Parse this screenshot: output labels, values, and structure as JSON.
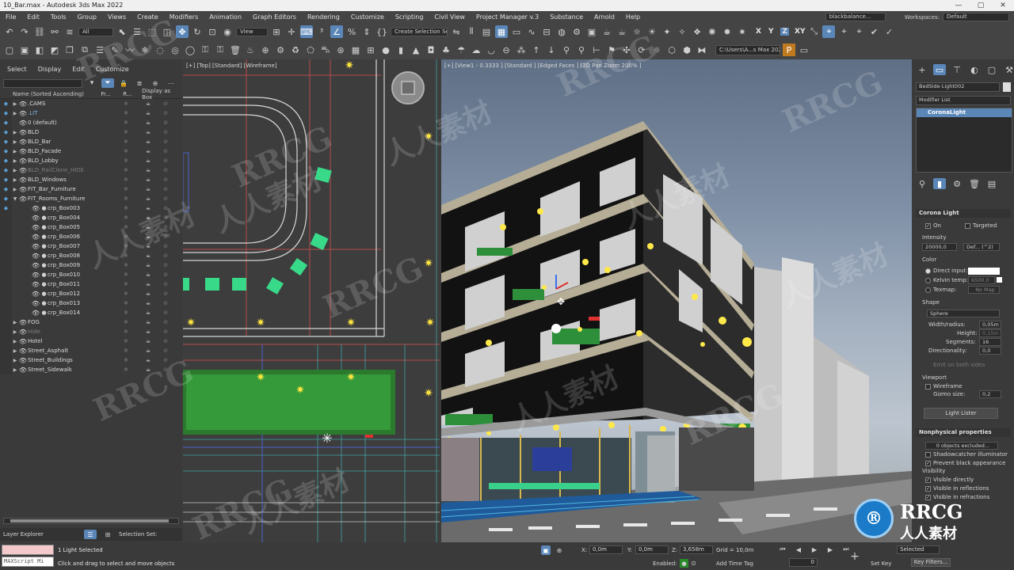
{
  "title_bar": {
    "title": "10_Bar.max - Autodesk 3ds Max 2022",
    "minimize": "—",
    "maximize": "▢",
    "close": "✕"
  },
  "menu": {
    "items": [
      "File",
      "Edit",
      "Tools",
      "Group",
      "Views",
      "Create",
      "Modifiers",
      "Animation",
      "Graph Editors",
      "Rendering",
      "Customize",
      "Scripting",
      "Civil View",
      "Project Manager v.3",
      "Substance",
      "Arnold",
      "Help"
    ],
    "user": "blackbalance...",
    "workspaces_label": "Workspaces:",
    "workspace": "Default"
  },
  "toolbar1": {
    "selection_filter": "All",
    "view_dropdown": "View",
    "selection_set": "Create Selection Se",
    "axis_x": "X",
    "axis_y": "Y",
    "axis_z": "Z",
    "axis_xy": "XY"
  },
  "toolbar2": {
    "project_path": "C:\\Users\\A...s Max 2022"
  },
  "scene_explorer": {
    "tabs": [
      "Select",
      "Display",
      "Edit",
      "Customize"
    ],
    "columns": [
      "Name (Sorted Ascending)",
      "Fr...",
      "R...",
      "Display as Box"
    ],
    "rows": [
      {
        "name": ".CAMS",
        "expand": "▶",
        "sel": false,
        "dim": false,
        "indent": 0
      },
      {
        "name": ".LIT",
        "expand": "▶",
        "sel": true,
        "dim": false,
        "indent": 0
      },
      {
        "name": "0 (default)",
        "expand": "",
        "sel": false,
        "dim": false,
        "indent": 0
      },
      {
        "name": "BLD",
        "expand": "▶",
        "sel": false,
        "dim": false,
        "indent": 0
      },
      {
        "name": "BLD_Bar",
        "expand": "▶",
        "sel": false,
        "dim": false,
        "indent": 0
      },
      {
        "name": "BLD_Facade",
        "expand": "▶",
        "sel": false,
        "dim": false,
        "indent": 0
      },
      {
        "name": "BLD_Lobby",
        "expand": "▶",
        "sel": false,
        "dim": false,
        "indent": 0
      },
      {
        "name": "BLD_RailClone_HIDE",
        "expand": "▶",
        "sel": false,
        "dim": true,
        "indent": 0
      },
      {
        "name": "BLD_Windows",
        "expand": "▶",
        "sel": false,
        "dim": false,
        "indent": 0
      },
      {
        "name": "FIT_Bar_Furniture",
        "expand": "▶",
        "sel": false,
        "dim": false,
        "indent": 0
      },
      {
        "name": "FIT_Rooms_Furniture",
        "expand": "▼",
        "sel": false,
        "dim": false,
        "indent": 0
      },
      {
        "name": "crp_Box003",
        "expand": "",
        "sel": false,
        "dim": false,
        "indent": 1
      },
      {
        "name": "crp_Box004",
        "expand": "",
        "sel": false,
        "dim": false,
        "indent": 1
      },
      {
        "name": "crp_Box005",
        "expand": "",
        "sel": false,
        "dim": false,
        "indent": 1
      },
      {
        "name": "crp_Box006",
        "expand": "",
        "sel": false,
        "dim": false,
        "indent": 1
      },
      {
        "name": "crp_Box007",
        "expand": "",
        "sel": false,
        "dim": false,
        "indent": 1
      },
      {
        "name": "crp_Box008",
        "expand": "",
        "sel": false,
        "dim": false,
        "indent": 1
      },
      {
        "name": "crp_Box009",
        "expand": "",
        "sel": false,
        "dim": false,
        "indent": 1
      },
      {
        "name": "crp_Box010",
        "expand": "",
        "sel": false,
        "dim": false,
        "indent": 1
      },
      {
        "name": "crp_Box011",
        "expand": "",
        "sel": false,
        "dim": false,
        "indent": 1
      },
      {
        "name": "crp_Box012",
        "expand": "",
        "sel": false,
        "dim": false,
        "indent": 1
      },
      {
        "name": "crp_Box013",
        "expand": "",
        "sel": false,
        "dim": false,
        "indent": 1
      },
      {
        "name": "crp_Box014",
        "expand": "",
        "sel": false,
        "dim": false,
        "indent": 1
      },
      {
        "name": "FOG",
        "expand": "▶",
        "sel": false,
        "dim": false,
        "indent": 0
      },
      {
        "name": "Hide",
        "expand": "▶",
        "sel": false,
        "dim": true,
        "indent": 0
      },
      {
        "name": "Hotel",
        "expand": "▶",
        "sel": false,
        "dim": false,
        "indent": 0
      },
      {
        "name": "Street_Asphalt",
        "expand": "▶",
        "sel": false,
        "dim": false,
        "indent": 0
      },
      {
        "name": "Street_Buildings",
        "expand": "▶",
        "sel": false,
        "dim": false,
        "indent": 0
      },
      {
        "name": "Street_Sidewalk",
        "expand": "▶",
        "sel": false,
        "dim": false,
        "indent": 0
      }
    ],
    "footer_left": "Layer Explorer",
    "footer_right": "Selection Set:"
  },
  "viewport_top": {
    "label": "[+] [Top] [Standard] [Wireframe]"
  },
  "viewport_persp": {
    "label": "[+] [View1 - 0.3333 ] [Standard ] [Edged Faces ] [2D Pan Zoom 200% ]"
  },
  "command_panel": {
    "object_name": "BedSide Light002",
    "modifier_list": "Modifier List",
    "stack_item": "CoronaLight",
    "corona_light": {
      "title": "Corona Light",
      "on": "On",
      "targeted": "Targeted",
      "intensity_label": "Intensity",
      "intensity": "20000,0",
      "unit": "Def... (^2)",
      "color_label": "Color",
      "direct_input": "Direct input:",
      "kelvin": "Kelvin temp:",
      "kelvin_val": "6500,0",
      "texmap": "Texmap:",
      "no_map": "No Map",
      "shape_label": "Shape",
      "shape": "Sphere",
      "width_label": "Width/radius:",
      "width": "0,05m",
      "height_label": "Height:",
      "height": "0,15m",
      "segments_label": "Segments:",
      "segments": "16",
      "directionality_label": "Directionality:",
      "directionality": "0,0",
      "emit_both": "Emit on both sides",
      "viewport_label": "Viewport",
      "wireframe": "Wireframe",
      "gizmo_label": "Gizmo size:",
      "gizmo": "0,2",
      "light_lister": "Light Lister"
    },
    "nonphysical": {
      "title": "Nonphysical properties",
      "objects_excluded": "0 objects excluded...",
      "shadowcatcher": "Shadowcatcher illuminator",
      "prevent_black": "Prevent black appearance",
      "visibility_label": "Visibility",
      "vis_direct": "Visible directly",
      "vis_refl": "Visible in reflections",
      "vis_refr": "Visible in refractions"
    }
  },
  "status": {
    "maxscript": "MAXScript Mi",
    "selected": "1 Light Selected",
    "prompt": "Click and drag to select and move objects",
    "x_label": "X:",
    "x": "0,0m",
    "y_label": "Y:",
    "y": "0,0m",
    "z_label": "Z:",
    "z": "3,658m",
    "grid": "Grid = 10,0m",
    "enabled": "Enabled:",
    "add_time_tag": "Add Time Tag",
    "frame": "0",
    "selected_dd": "Selected",
    "set_key": "Set Key",
    "key_filters": "Key Filters..."
  },
  "watermark": {
    "rrcg": "RRCG",
    "cn": "人人素材"
  }
}
